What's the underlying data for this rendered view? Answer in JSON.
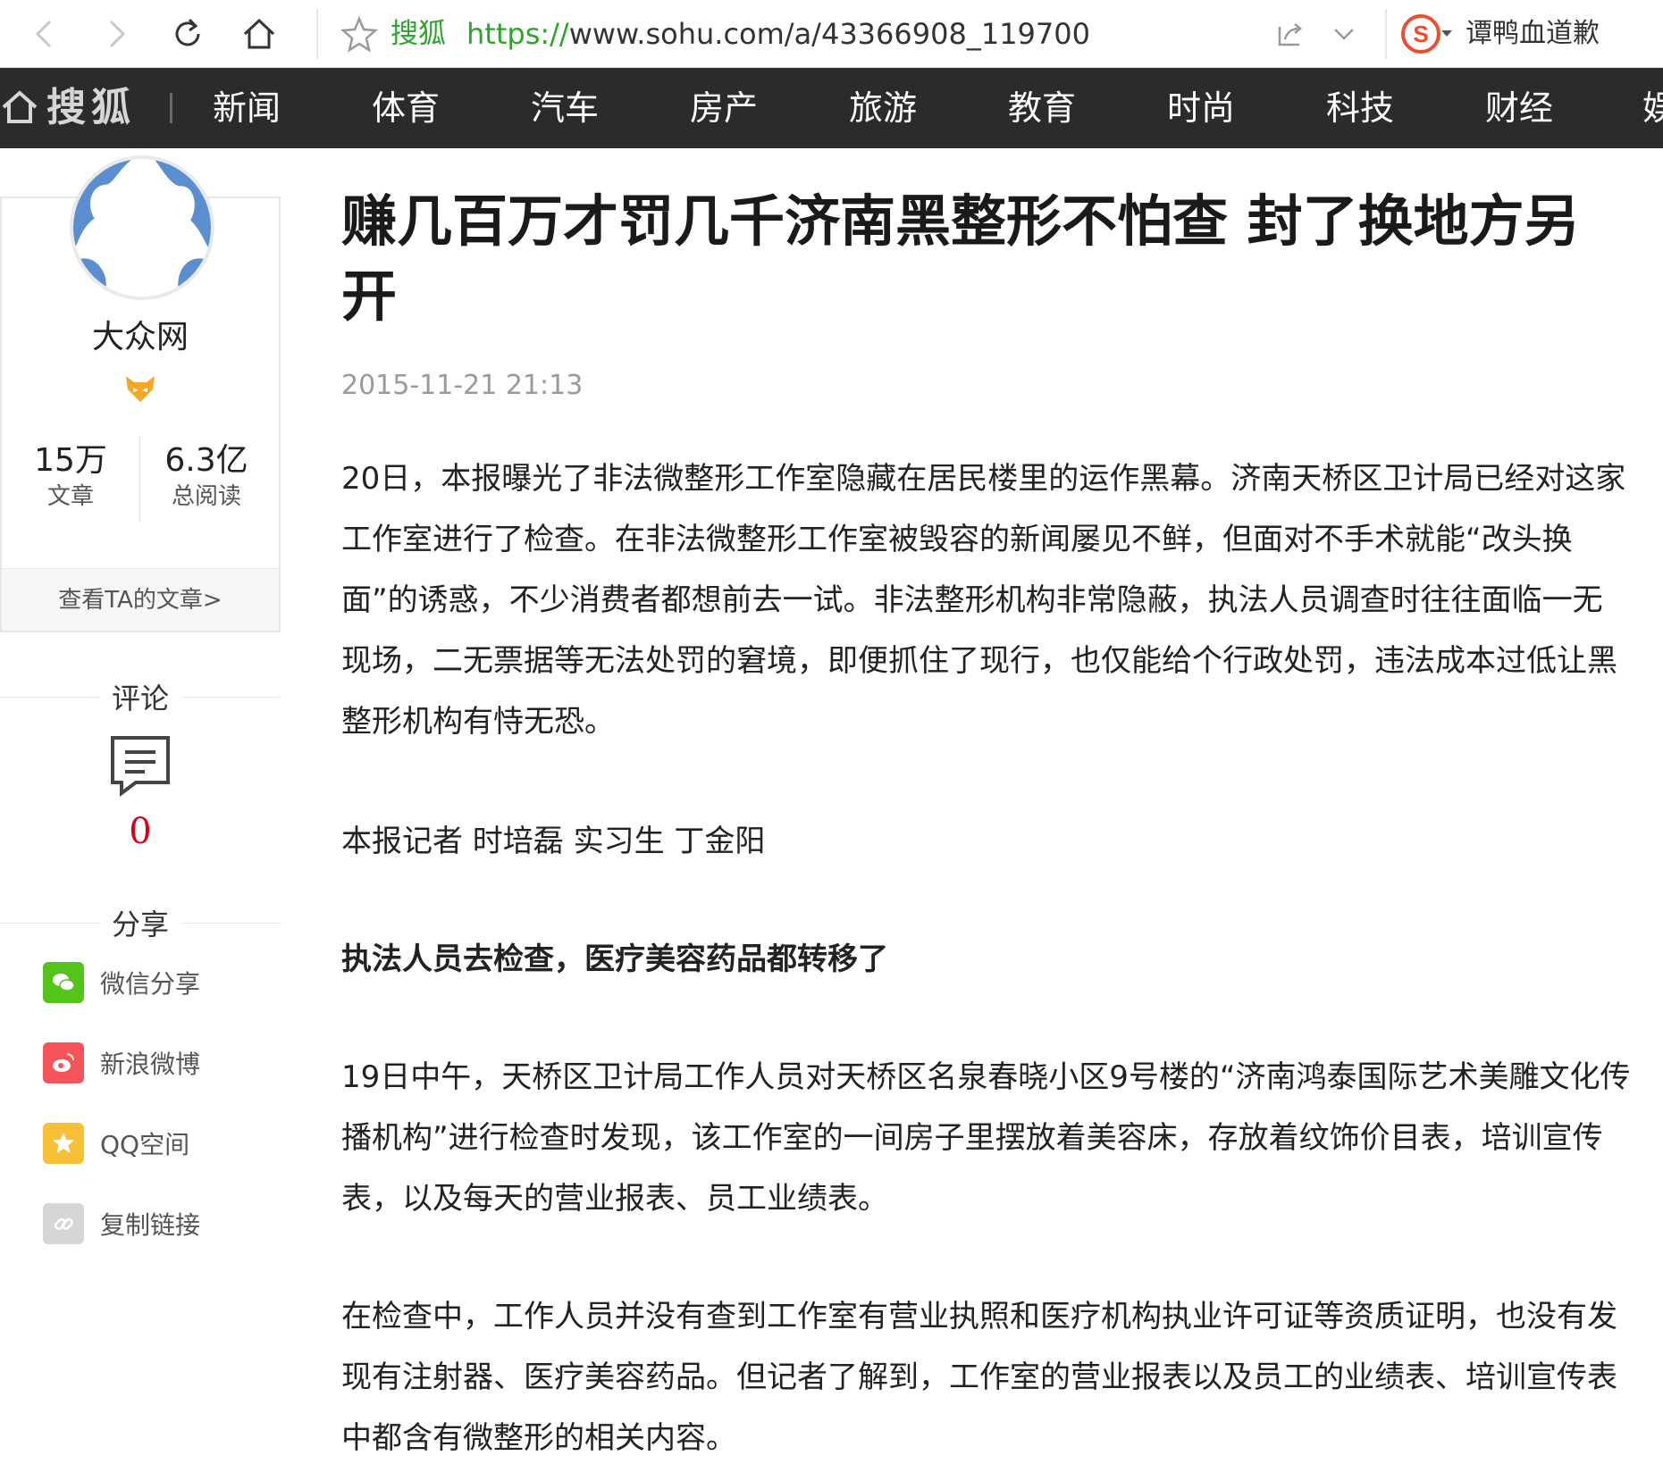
{
  "browser": {
    "site_label": "搜狐",
    "url_scheme": "https://",
    "url_rest": "www.sohu.com/a/43366908_119700",
    "search_text": "谭鸭血道歉"
  },
  "nav": {
    "logo": "搜狐",
    "items": [
      "新闻",
      "体育",
      "汽车",
      "房产",
      "旅游",
      "教育",
      "时尚",
      "科技",
      "财经",
      "娱"
    ]
  },
  "author": {
    "name": "大众网",
    "articles_count": "15万",
    "articles_label": "文章",
    "reads_count": "6.3亿",
    "reads_label": "总阅读",
    "view_all": "查看TA的文章>"
  },
  "comment": {
    "title": "评论",
    "count": "0"
  },
  "share": {
    "title": "分享",
    "items": [
      {
        "label": "微信分享",
        "color": "#52c41a"
      },
      {
        "label": "新浪微博",
        "color": "#f5545b"
      },
      {
        "label": "QQ空间",
        "color": "#f8c036"
      },
      {
        "label": "复制链接",
        "color": "#d6d6d6"
      }
    ]
  },
  "article": {
    "title": "赚几百万才罚几千济南黑整形不怕查 封了换地方另开",
    "date": "2015-11-21 21:13",
    "paragraphs": [
      "20日，本报曝光了非法微整形工作室隐藏在居民楼里的运作黑幕。济南天桥区卫计局已经对这家工作室进行了检查。在非法微整形工作室被毁容的新闻屡见不鲜，但面对不手术就能“改头换面”的诱惑，不少消费者都想前去一试。非法整形机构非常隐蔽，执法人员调查时往往面临一无现场，二无票据等无法处罚的窘境，即便抓住了现行，也仅能给个行政处罚，违法成本过低让黑整形机构有恃无恐。",
      "本报记者 时培磊 实习生 丁金阳",
      "执法人员去检查，医疗美容药品都转移了",
      "19日中午，天桥区卫计局工作人员对天桥区名泉春晓小区9号楼的“济南鸿泰国际艺术美雕文化传播机构”进行检查时发现，该工作室的一间房子里摆放着美容床，存放着纹饰价目表，培训宣传表，以及每天的营业报表、员工业绩表。",
      "在检查中，工作人员并没有查到工作室有营业执照和医疗机构执业许可证等资质证明，也没有发现有注射器、医疗美容药品。但记者了解到，工作室的营业报表以及员工的业绩表、培训宣传表中都含有微整形的相关内容。"
    ]
  },
  "colors": {
    "nav_bg": "#2b2b2b",
    "accent_green": "#2aa52a",
    "comment_red": "#d9001b"
  }
}
